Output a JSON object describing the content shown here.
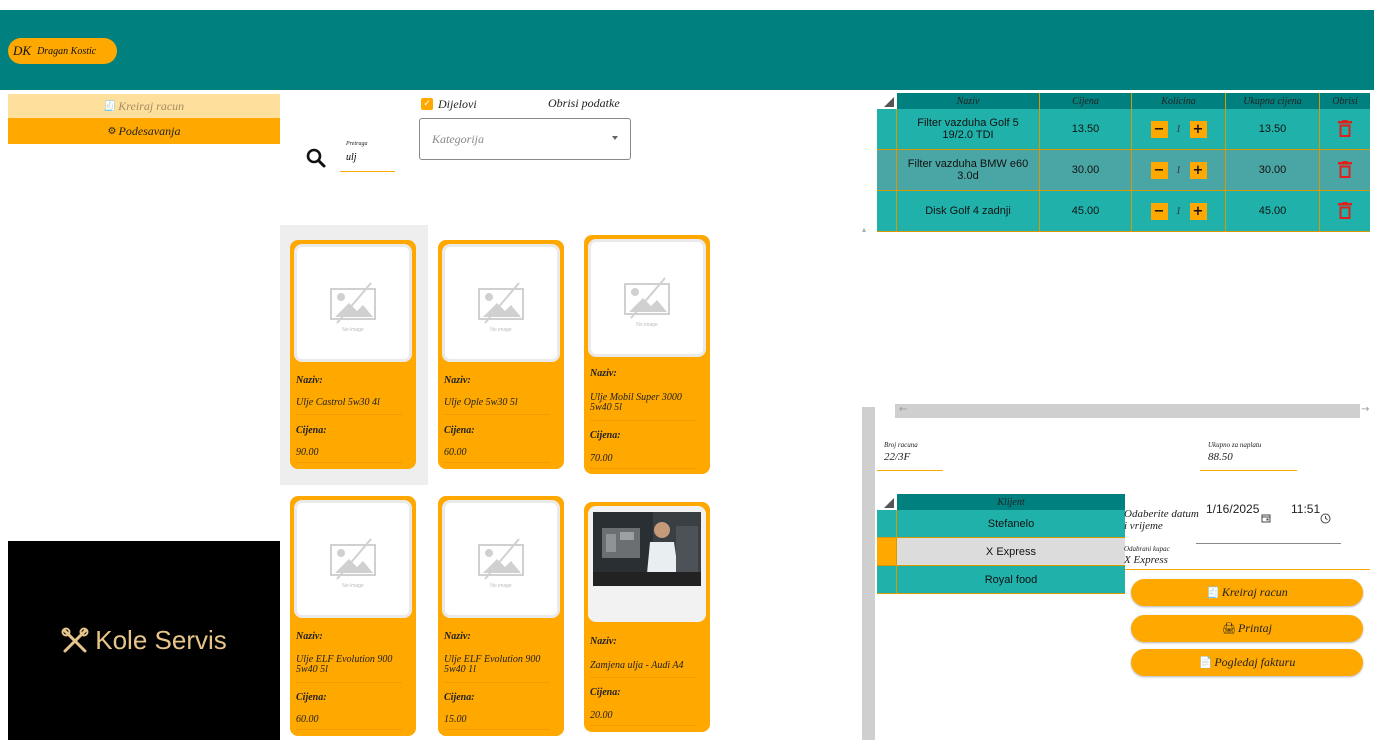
{
  "user": {
    "initials": "DK",
    "name": "Dragan Kostic"
  },
  "sidebar": {
    "items": [
      {
        "label": "Kreiraj racun",
        "icon": "receipt-icon"
      },
      {
        "label": "Podesavanja",
        "icon": "gear-icon"
      }
    ],
    "logo_text": "Kole Servis"
  },
  "search": {
    "label": "Pretraga",
    "value": "ulj"
  },
  "filter": {
    "checkbox_label": "Dijelovi",
    "checked": true,
    "clear_label": "Obrisi podatke",
    "category_placeholder": "Kategorija"
  },
  "products": [
    {
      "image_text": "No image",
      "name_label": "Naziv:",
      "name": "Ulje Castrol 5w30 4l",
      "price_label": "Cijena:",
      "price": "90.00"
    },
    {
      "image_text": "No image",
      "name_label": "Naziv:",
      "name": "Ulje Ople 5w30 5l",
      "price_label": "Cijena:",
      "price": "60.00"
    },
    {
      "image_text": "No image",
      "name_label": "Naziv:",
      "name": "Ulje Mobil Super 3000 5w40 5l",
      "price_label": "Cijena:",
      "price": "70.00"
    },
    {
      "image_text": "No image",
      "name_label": "Naziv:",
      "name": "Ulje ELF Evolution 900 5w40 5l",
      "price_label": "Cijena:",
      "price": "60.00"
    },
    {
      "image_text": "No image",
      "name_label": "Naziv:",
      "name": "Ulje ELF Evolution 900 5w40 1l",
      "price_label": "Cijena:",
      "price": "15.00"
    },
    {
      "image_text": "",
      "name_label": "Naziv:",
      "name": "Zamjena ulja - Audi A4",
      "price_label": "Cijena:",
      "price": "20.00"
    }
  ],
  "cart": {
    "headers": [
      "Naziv",
      "Cijena",
      "Kolicina",
      "Ukupna cijena",
      "Obrisi"
    ],
    "rows": [
      {
        "name": "Filter vazduha Golf 5 19/2.0 TDI",
        "price": "13.50",
        "qty": "1",
        "total": "13.50"
      },
      {
        "name": "Filter vazduha BMW e60 3.0d",
        "price": "30.00",
        "qty": "1",
        "total": "30.00"
      },
      {
        "name": "Disk Golf 4 zadnji",
        "price": "45.00",
        "qty": "1",
        "total": "45.00"
      }
    ],
    "minus": "−",
    "plus": "+"
  },
  "invoice": {
    "number_label": "Broj racuna",
    "number": "22/3F",
    "total_label": "Ukupno za naplatu",
    "total": "88.50",
    "datetime_label": "Odaberite datum i vrijeme",
    "date": "1/16/2025",
    "time": "11:51",
    "selected_customer_label": "Odabrani kupac",
    "selected_customer": "X Express"
  },
  "clients": {
    "header": "Klijent",
    "rows": [
      "Stefanelo",
      "X Express",
      "Royal food"
    ]
  },
  "actions": {
    "create": "Kreiraj racun",
    "print": "Printaj",
    "view": "Pogledaj fakturu"
  },
  "colors": {
    "teal": "#00807e",
    "accent": "#ffa800",
    "row": "#20b2aa",
    "delete": "#e0201b"
  }
}
